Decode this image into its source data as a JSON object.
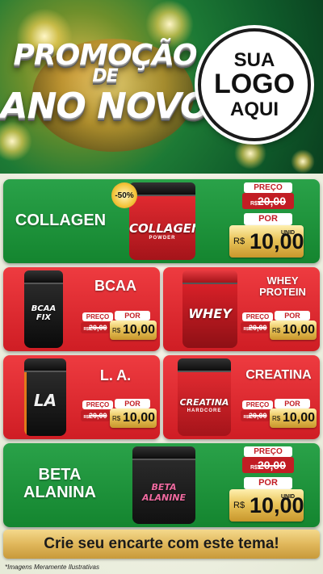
{
  "header": {
    "promo_line1": "PROMOÇÃO",
    "promo_line2": "DE",
    "promo_line3": "ANO NOVO",
    "logo_line1": "SUA",
    "logo_line2": "LOGO",
    "logo_line3": "AQUI"
  },
  "price_labels": {
    "preco": "PREÇO",
    "por": "POR",
    "currency": "R$",
    "unit": "UNID"
  },
  "products": {
    "collagen": {
      "name": "COLLAGEN",
      "badge": "-50%",
      "old_price": "20,00",
      "new_price": "10,00",
      "jar_text": "COLLAGEN",
      "jar_sub": "POWDER"
    },
    "bcaa": {
      "name": "BCAA",
      "old_price": "20,00",
      "new_price": "10,00",
      "jar_text": "BCAA FIX"
    },
    "whey": {
      "name": "WHEY PROTEIN",
      "old_price": "20,00",
      "new_price": "10,00",
      "jar_text": "WHEY"
    },
    "la": {
      "name": "L. A.",
      "old_price": "20,00",
      "new_price": "10,00",
      "jar_text": "LA"
    },
    "creatina": {
      "name": "CREATINA",
      "old_price": "20,00",
      "new_price": "10,00",
      "jar_text": "CREATINA",
      "jar_sub": "HARDCORE"
    },
    "beta": {
      "name_line1": "BETA",
      "name_line2": "ALANINA",
      "old_price": "20,00",
      "new_price": "10,00",
      "jar_text": "BETA ALANINE"
    }
  },
  "footer": {
    "cta": "Crie seu encarte com este tema!",
    "disclaimer": "*Imagens Meramente Ilustrativas"
  },
  "colors": {
    "green": "#14852f",
    "red": "#cf1d24",
    "gold": "#e0b75b"
  }
}
